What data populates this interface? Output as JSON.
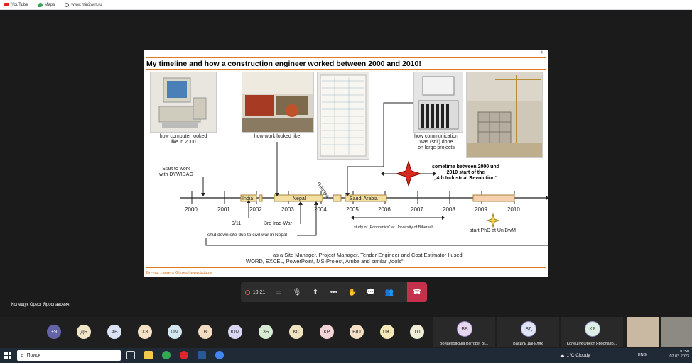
{
  "bookmarks": [
    {
      "label": "YouTube",
      "icon": "youtube-icon",
      "color": "#e62117"
    },
    {
      "label": "Maps",
      "icon": "maps-icon",
      "color": "#34a853"
    },
    {
      "label": "www.min2win.ru",
      "icon": "globe-icon",
      "color": "#555555"
    }
  ],
  "slide": {
    "number": "4",
    "title": "My timeline and how a construction engineer worked between 2000 and 2010!",
    "captions": {
      "computer": [
        "how computer looked",
        "like in 2000"
      ],
      "work": "how work looked like",
      "communication": [
        "how communication",
        "was (still) done",
        "on large projects"
      ]
    },
    "start_label": [
      "Start to work",
      "with DYWIDAG"
    ],
    "revolution": [
      "sometime between 2000 und",
      "2010 start of the",
      "„4th Industrial Revolution“"
    ],
    "years": [
      "2000",
      "2001",
      "2002",
      "2003",
      "2004",
      "2005",
      "2006",
      "2007",
      "2008",
      "2009",
      "2010"
    ],
    "countries": {
      "india": "India",
      "nepal": "Nepal",
      "georgia": "Georgia",
      "saudi": "Saudi Arabia"
    },
    "events": {
      "nine_eleven": "9/11",
      "iraq": "3rd Iraq-War",
      "shutdown": "shut down site due to civil war in Nepal",
      "study": "study of „Economics“ at University of Biberach",
      "phd": "start PhD at UniBwM"
    },
    "summary": [
      "as a Site Manager, Project Manager, Tender Engineer and Cost Estimator I used:",
      "WORD, EXCEL, PowerPoint, MS-Project, Arriba and similar „tools“"
    ],
    "footer": "Dr.-Ing. Laurenz Görres | www.bclg.de",
    "accent": "#e07a1f"
  },
  "controls": {
    "timer": "10:21"
  },
  "presenter_name": "Колещук Орест Ярославович",
  "participants": {
    "more": "+9",
    "initials": [
      "ДБ",
      "АВ",
      "ХЗ",
      "ОМ",
      "В",
      "ЮМ",
      "ЗБ",
      "КС",
      "КР",
      "БЮ",
      "ЦЮ",
      "ТП"
    ],
    "tiles": [
      {
        "initials": "ВВ",
        "name": "Войцеховська Вікторія Ві..."
      },
      {
        "initials": "ВД",
        "name": "Василь Даниляк"
      },
      {
        "initials": "КЯ",
        "name": "Колещук Орест Ярославо..."
      }
    ]
  },
  "taskbar": {
    "search_placeholder": "Поиск",
    "weather": "1°C  Cloudy",
    "lang": "ENG",
    "time": "10:50",
    "date": "07.03.2023"
  }
}
